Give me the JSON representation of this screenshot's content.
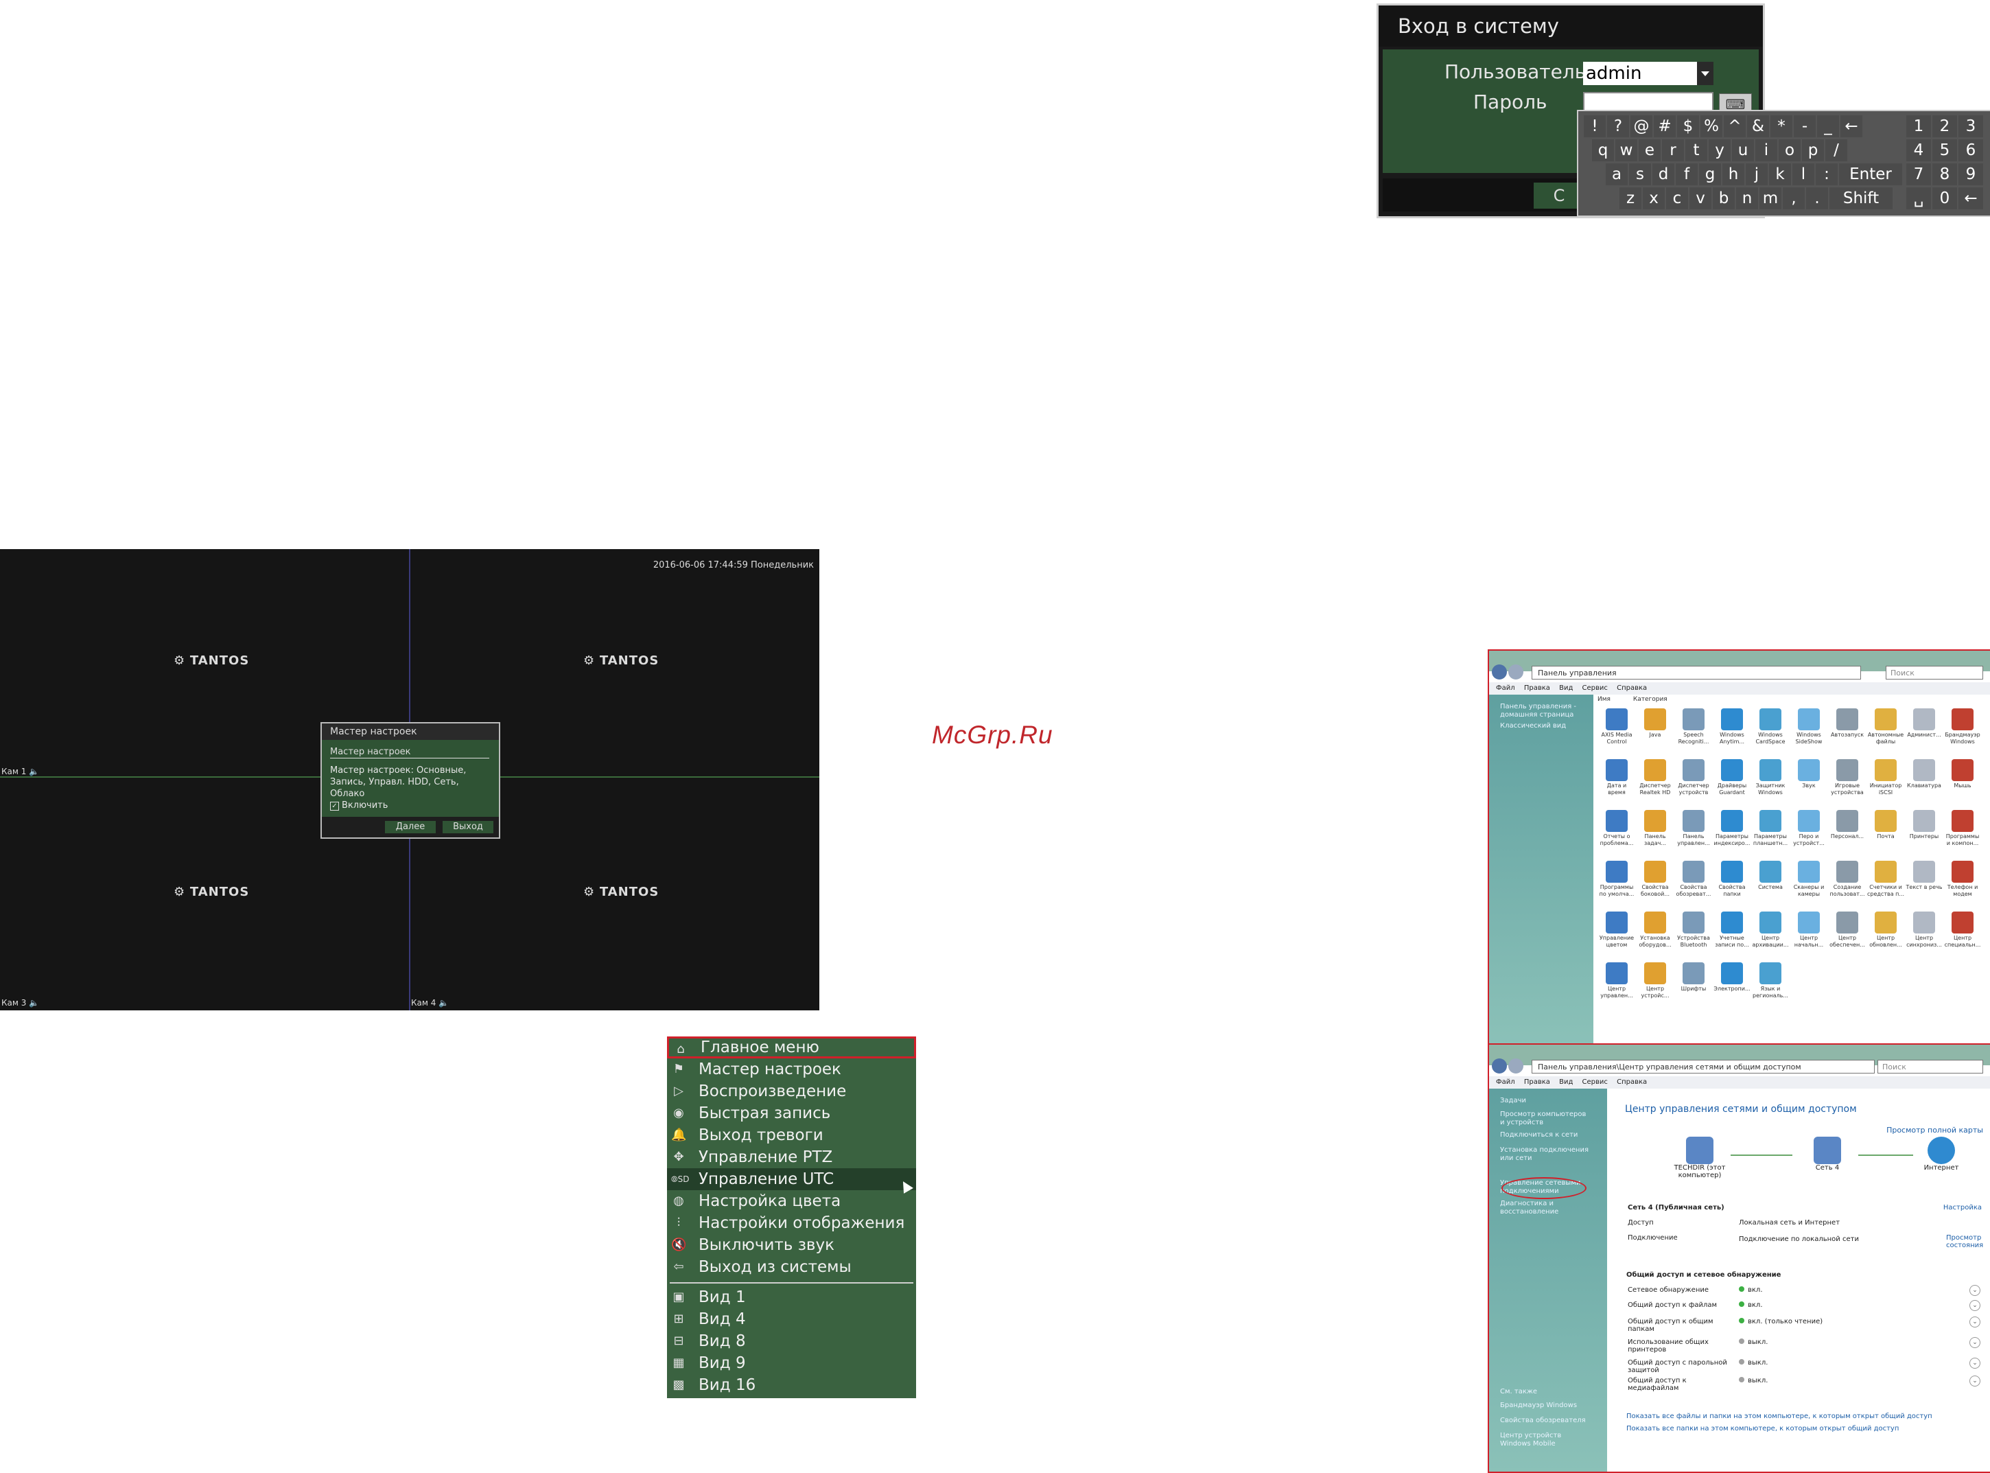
{
  "login": {
    "title": "Вход в систему",
    "user_label": "Пользователь",
    "user_value": "admin",
    "password_label": "Пароль",
    "ok_label": "С",
    "keyboard": {
      "row1": [
        "!",
        "?",
        "@",
        "#",
        "$",
        "%",
        "^",
        "&",
        "*",
        "-",
        "_",
        "←"
      ],
      "row2": [
        "q",
        "w",
        "e",
        "r",
        "t",
        "y",
        "u",
        "i",
        "o",
        "p",
        "/"
      ],
      "row3": [
        "a",
        "s",
        "d",
        "f",
        "g",
        "h",
        "j",
        "k",
        "l",
        ":",
        "Enter"
      ],
      "row4": [
        "z",
        "x",
        "c",
        "v",
        "b",
        "n",
        "m",
        ",",
        ".",
        "Shift"
      ],
      "num1": [
        "1",
        "2",
        "3"
      ],
      "num2": [
        "4",
        "5",
        "6"
      ],
      "num3": [
        "7",
        "8",
        "9"
      ],
      "num4": [
        "␣",
        "0",
        "←"
      ]
    }
  },
  "dvr": {
    "timestamp": "2016-06-06 17:44:59 Понедельник",
    "logo": "TANTOS",
    "cams": [
      "Кам 1",
      "Кам 3",
      "Кам 4"
    ],
    "wizard": {
      "title": "Мастер настроек",
      "subtitle": "Мастер настроек",
      "description": "Мастер настроек: Основные, Запись, Управл. HDD, Сеть, Облако",
      "enable_label": "Включить",
      "next_label": "Далее",
      "exit_label": "Выход"
    }
  },
  "watermark": "McGrp.Ru",
  "menu": {
    "items": [
      {
        "label": "Главное меню",
        "icon": "home-icon"
      },
      {
        "label": "Мастер настроек",
        "icon": "flag-icon"
      },
      {
        "label": "Воспроизведение",
        "icon": "play-icon"
      },
      {
        "label": "Быстрая запись",
        "icon": "record-icon"
      },
      {
        "label": "Выход тревоги",
        "icon": "bell-icon"
      },
      {
        "label": "Управление PTZ",
        "icon": "ptz-icon"
      },
      {
        "label": "Управление UTC",
        "icon": "osd-icon"
      },
      {
        "label": "Настройка цвета",
        "icon": "palette-icon"
      },
      {
        "label": "Настройки отображения",
        "icon": "sliders-icon"
      },
      {
        "label": "Выключить звук",
        "icon": "mute-icon"
      },
      {
        "label": "Выход из системы",
        "icon": "logout-icon"
      }
    ],
    "views": [
      {
        "label": "Вид 1",
        "icon": "view1-icon"
      },
      {
        "label": "Вид 4",
        "icon": "view4-icon"
      },
      {
        "label": "Вид 8",
        "icon": "view8-icon"
      },
      {
        "label": "Вид 9",
        "icon": "view9-icon"
      },
      {
        "label": "Вид 16",
        "icon": "view16-icon"
      }
    ]
  },
  "win1": {
    "address": "Панель управления",
    "search": "Поиск",
    "menubar": [
      "Файл",
      "Правка",
      "Вид",
      "Сервис",
      "Справка"
    ],
    "sidebar": [
      "Панель управления - домашняя страница",
      "Классический вид"
    ],
    "view_tabs": [
      "Имя",
      "Категория"
    ],
    "icons": [
      "AXIS Media Control",
      "Java",
      "Speech Recogniti...",
      "Windows Anytim...",
      "Windows CardSpace",
      "Windows SideShow",
      "Автозапуск",
      "Автономные файлы",
      "Админист...",
      "Брандмауэр Windows",
      "Дата и время",
      "Диспетчер Realtek HD",
      "Диспетчер устройств",
      "Драйверы Guardant",
      "Защитник Windows",
      "Звук",
      "Игровые устройства",
      "Инициатор iSCSI",
      "Клавиатура",
      "Мышь",
      "Отчеты о проблема...",
      "Панель задач...",
      "Панель управлен...",
      "Параметры индексиро...",
      "Параметры планшетн...",
      "Перо и устройст...",
      "Персонал...",
      "Почта",
      "Принтеры",
      "Программы и компон...",
      "Программы по умолча...",
      "Свойства боковой...",
      "Свойства обозреват...",
      "Свойства папки",
      "Система",
      "Сканеры и камеры",
      "Создание пользоват...",
      "Счетчики и средства п...",
      "Текст в речь",
      "Телефон и модем",
      "Управление цветом",
      "Установка оборудов...",
      "Устройства Bluetooth",
      "Учетные записи по...",
      "Центр архивации...",
      "Центр начальн...",
      "Центр обеспечен...",
      "Центр обновлен...",
      "Центр синхрониз...",
      "Центр специальн...",
      "Центр управлен...",
      "Центр устройс...",
      "Шрифты",
      "Электропи...",
      "Язык и региональ..."
    ]
  },
  "win2": {
    "address": "Панель управления\\Центр управления сетями и общим доступом",
    "search": "Поиск",
    "menubar": [
      "Файл",
      "Правка",
      "Вид",
      "Сервис",
      "Справка"
    ],
    "sidebar_title": "Задачи",
    "sidebar": [
      "Просмотр компьютеров и устройств",
      "Подключиться к сети",
      "Установка подключения или сети",
      "Управление сетевыми подключениями",
      "Диагностика и восстановление"
    ],
    "sidebar_bottom": [
      "См. также",
      "Брандмауэр Windows",
      "Свойства обозревателя",
      "Центр устройств Windows Mobile"
    ],
    "heading": "Центр управления сетями и общим доступом",
    "full_map": "Просмотр полной карты",
    "node_pc": "TECHDIR (этот компьютер)",
    "node_net": "Сеть 4",
    "node_inet": "Интернет",
    "network_name": "Сеть 4 (Публичная сеть)",
    "configure": "Настройка",
    "access_label": "Доступ",
    "access_value": "Локальная сеть и Интернет",
    "conn_label": "Подключение",
    "conn_value": "Подключение по локальной сети",
    "view_status": "Просмотр состояния",
    "sharing_title": "Общий доступ и сетевое обнаружение",
    "sharing": [
      {
        "k": "Сетевое обнаружение",
        "v": "вкл.",
        "on": true
      },
      {
        "k": "Общий доступ к файлам",
        "v": "вкл.",
        "on": true
      },
      {
        "k": "Общий доступ к общим папкам",
        "v": "вкл. (только чтение)",
        "on": true
      },
      {
        "k": "Использование общих принтеров",
        "v": "выкл.",
        "on": false
      },
      {
        "k": "Общий доступ с парольной защитой",
        "v": "выкл.",
        "on": false
      },
      {
        "k": "Общий доступ к медиафайлам",
        "v": "выкл.",
        "on": false
      }
    ],
    "bottom_links": [
      "Показать все файлы и папки на этом компьютере, к которым открыт общий доступ",
      "Показать все папки на этом компьютере, к которым открыт общий доступ"
    ]
  }
}
